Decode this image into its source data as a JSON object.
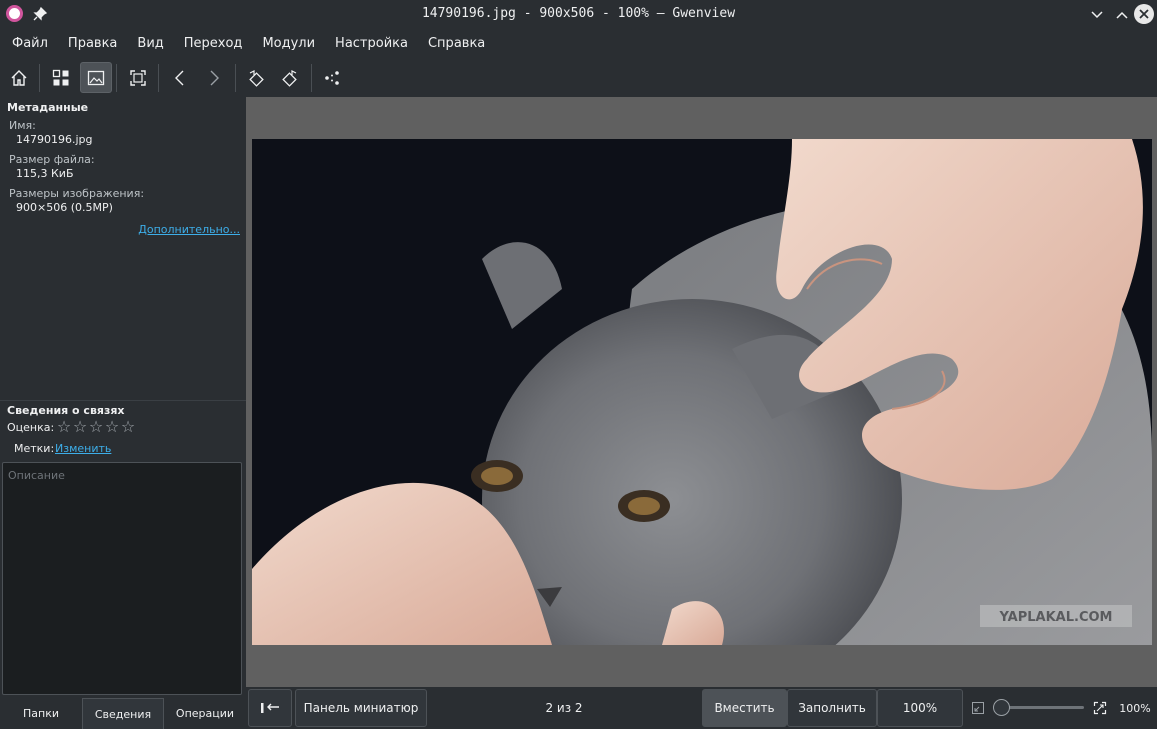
{
  "window": {
    "title": "14790196.jpg - 900x506 - 100% — Gwenview"
  },
  "menu": [
    "Файл",
    "Правка",
    "Вид",
    "Переход",
    "Модули",
    "Настройка",
    "Справка"
  ],
  "toolbar": {
    "icons": [
      "home-icon",
      "browse-grid-icon",
      "view-image-icon",
      "fullscreen-icon",
      "previous-icon",
      "next-icon",
      "rotate-left-icon",
      "rotate-right-icon",
      "share-icon"
    ]
  },
  "sidebar": {
    "metadata_title": "Метаданные",
    "name_label": "Имя:",
    "name_value": "14790196.jpg",
    "filesize_label": "Размер файла:",
    "filesize_value": "115,3 КиБ",
    "dimensions_label": "Размеры изображения:",
    "dimensions_value": "900×506 (0.5MP)",
    "more_link": "Дополнительно...",
    "semantic_title": "Сведения о связях",
    "rating_label": "Оценка:",
    "rating_value": 0,
    "rating_max": 5,
    "tags_label": "Метки:",
    "tags_edit": "Изменить",
    "description_placeholder": "Описание",
    "tabs": [
      "Папки",
      "Сведения",
      "Операции"
    ],
    "active_tab": "Сведения"
  },
  "image": {
    "watermark": "YAPLAKAL.COM"
  },
  "bottombar": {
    "thumbnail_toggle_icon": "thumbnail-bar-toggle-icon",
    "thumbnail_panel": "Панель миниатюр",
    "position": "2 из 2",
    "fit": "Вместить",
    "fill": "Заполнить",
    "zoom_button": "100%",
    "zoom_value": "100%",
    "zoom_slider_level": 0
  },
  "colors": {
    "accent": "#3daee9",
    "background": "#2a2e32",
    "viewer_bg": "#606060"
  }
}
